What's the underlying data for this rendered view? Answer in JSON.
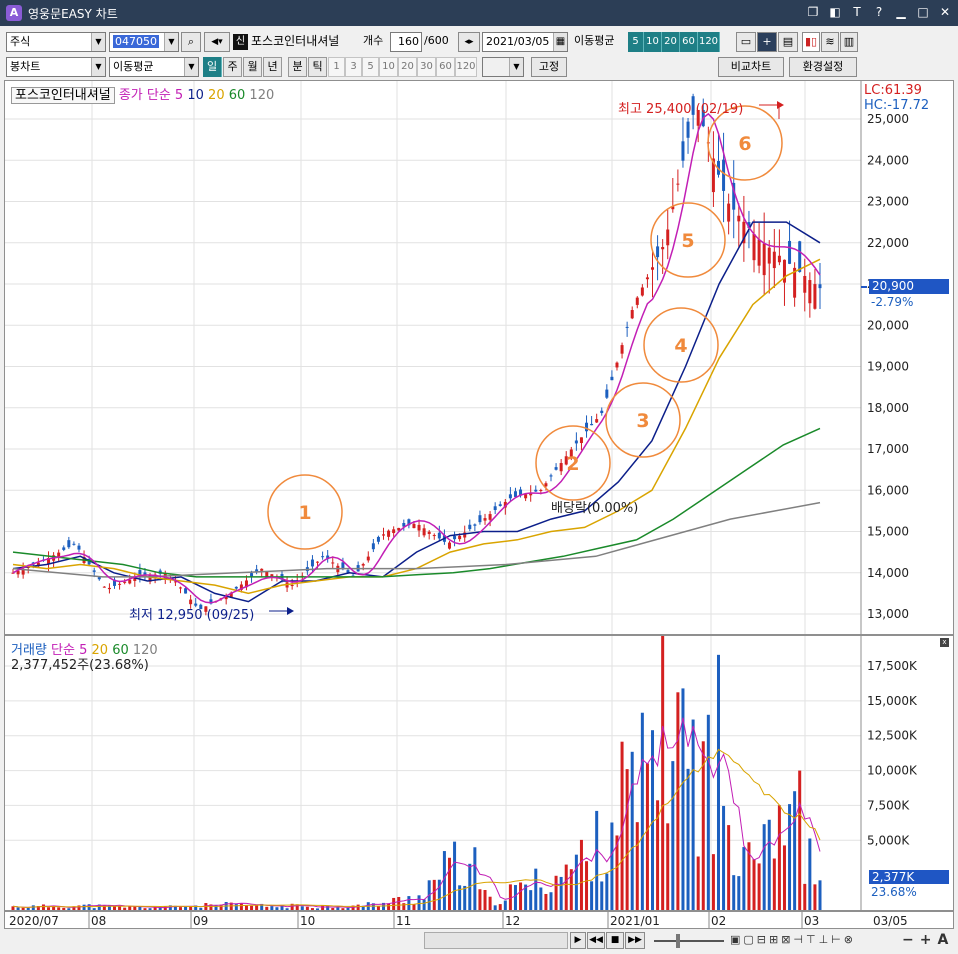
{
  "window": {
    "title": "영웅문EASY 차트",
    "app_icon": "A"
  },
  "toolbar1": {
    "market_type": "주식",
    "stock_code": "047050",
    "stock_name_badge": "신",
    "stock_name": "포스코인터내셔널",
    "count_label": "개수",
    "count_value": "160",
    "count_max": "/600",
    "date_value": "2021/03/05",
    "ma_label": "이동평균",
    "ma_periods": [
      "5",
      "10",
      "20",
      "60",
      "120"
    ]
  },
  "toolbar2": {
    "chart_type": "봉차트",
    "indicator": "이동평균",
    "periods": [
      "일",
      "주",
      "월",
      "년",
      "분",
      "틱"
    ],
    "minute_options": [
      "1",
      "3",
      "5",
      "10",
      "20",
      "30",
      "60",
      "120"
    ],
    "fixed_label": "고정",
    "compare_label": "비교차트",
    "settings_label": "환경설정"
  },
  "price_chart": {
    "legend_name": "포스코인터내셔널",
    "legend_ma": "종가 단순 5",
    "legend_periods": [
      "10",
      "20",
      "60",
      "120"
    ],
    "lc": "LC:61.39",
    "hc": "HC:-17.72",
    "high_annotation": "최고 25,400 (02/19)",
    "low_annotation": "최저 12,950 (09/25)",
    "dividend_annotation": "배당락(0.00%)",
    "current_price": "20,900",
    "current_change": "-2.79%",
    "y_ticks": [
      "25,000",
      "24,000",
      "23,000",
      "22,000",
      "21,000",
      "20,000",
      "19,000",
      "18,000",
      "17,000",
      "16,000",
      "15,000",
      "14,000",
      "13,000"
    ],
    "circles": [
      "1",
      "2",
      "3",
      "4",
      "5",
      "6"
    ]
  },
  "volume_chart": {
    "legend_name": "거래량",
    "legend_ma": "단순 5",
    "legend_periods": [
      "20",
      "60",
      "120"
    ],
    "current_volume": "2,377,452주(23.68%)",
    "current_volume_tag": "2,377K",
    "current_volume_pct": "23.68%",
    "y_ticks": [
      "17,500K",
      "15,000K",
      "12,500K",
      "10,000K",
      "7,500K",
      "5,000K"
    ]
  },
  "x_axis": {
    "labels": [
      "2020/07",
      "08",
      "09",
      "10",
      "11",
      "12",
      "2021/01",
      "02",
      "03"
    ],
    "end_date": "03/05"
  },
  "colors": {
    "up": "#d42020",
    "down": "#1c5fbf",
    "ma5": "#c21fb5",
    "ma10": "#0c1f8a",
    "ma20": "#d9a400",
    "ma60": "#1a8a2a",
    "ma120": "#808080",
    "circle": "#f08a3c"
  },
  "chart_data": {
    "type": "candlestick",
    "title": "",
    "y_range": [
      12700,
      25500
    ],
    "x": [
      "2020/07",
      "08",
      "09",
      "10",
      "11",
      "12",
      "2021/01",
      "02",
      "03"
    ],
    "series": [
      {
        "name": "종가",
        "values": [
          14000,
          14300,
          14700,
          13600,
          13900,
          14000,
          13100,
          13500,
          14100,
          13700,
          14400,
          13900,
          15000,
          15200,
          14700,
          15200,
          15800,
          16000,
          17000,
          17900,
          20500,
          22000,
          25400,
          23000,
          22100,
          21500,
          20900
        ]
      },
      {
        "name": "10",
        "values": [
          14100,
          14200,
          14400,
          14000,
          13800,
          13900,
          13500,
          13300,
          13800,
          13800,
          14000,
          13900,
          14500,
          14900,
          15000,
          15000,
          15300,
          15500,
          16200,
          17200,
          19000,
          21000,
          22500,
          22500,
          22000
        ]
      },
      {
        "name": "20",
        "values": [
          14200,
          14100,
          14200,
          14100,
          13900,
          13800,
          13700,
          13500,
          13700,
          13800,
          13900,
          13900,
          14100,
          14500,
          14700,
          14800,
          15000,
          15100,
          15500,
          16000,
          17500,
          19200,
          20500,
          21200,
          21600
        ]
      },
      {
        "name": "60",
        "values": [
          14500,
          14400,
          14300,
          14200,
          14000,
          13900,
          13900,
          13900,
          13900,
          13900,
          13900,
          13950,
          14000,
          14100,
          14250,
          14400,
          14600,
          14800,
          15300,
          15900,
          16500,
          17100,
          17500
        ]
      },
      {
        "name": "120",
        "values": [
          14100,
          14000,
          13900,
          13900,
          13950,
          14000,
          14050,
          14100,
          14100,
          14100,
          14150,
          14200,
          14300,
          14400,
          14700,
          15000,
          15300,
          15500,
          15700
        ]
      }
    ],
    "volume_y_range": [
      0,
      18500
    ],
    "volume_values": [
      300,
      350,
      400,
      300,
      250,
      400,
      500,
      350,
      400,
      300,
      600,
      1200,
      4500,
      800,
      2300,
      3500,
      6300,
      14000,
      18500,
      9800,
      7000,
      10000,
      2377
    ]
  }
}
